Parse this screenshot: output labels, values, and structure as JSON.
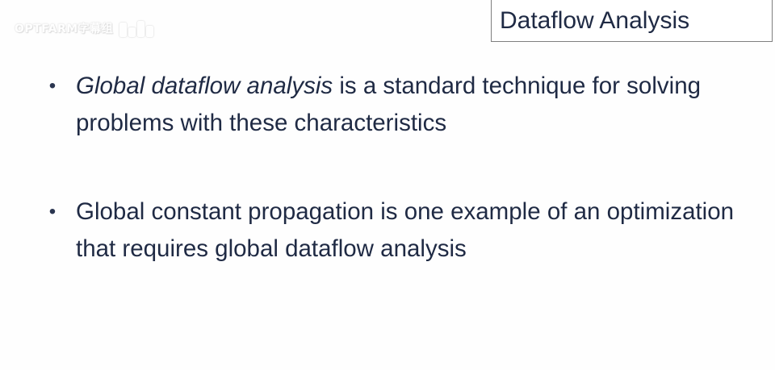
{
  "watermark": {
    "text": "OPTFARM字幕组"
  },
  "slide": {
    "title": "Dataflow Analysis",
    "bullets": [
      {
        "marker": "•",
        "emphasis": "Global dataflow analysis",
        "text": " is a standard technique for solving problems with these characteristics"
      },
      {
        "marker": "•",
        "emphasis": "",
        "text": "Global constant propagation is one example of an optimization that requires global dataflow analysis"
      }
    ]
  },
  "colors": {
    "text": "#1f2a44",
    "border": "#7f7f7f",
    "background": "#ffffff"
  }
}
